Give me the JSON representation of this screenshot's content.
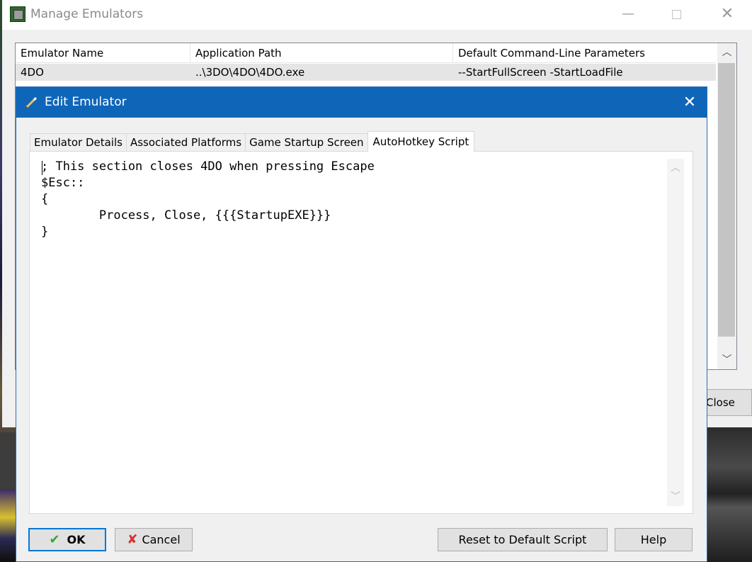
{
  "manage_window": {
    "title": "Manage Emulators",
    "columns": [
      "Emulator Name",
      "Application Path",
      "Default Command-Line Parameters"
    ],
    "rows": [
      {
        "name": "4DO",
        "path": "..\\3DO\\4DO\\4DO.exe",
        "params": "--StartFullScreen -StartLoadFile"
      }
    ],
    "partial_button_label": "Close"
  },
  "edit_dialog": {
    "title": "Edit Emulator",
    "tabs": [
      {
        "label": "Emulator Details",
        "active": false
      },
      {
        "label": "Associated Platforms",
        "active": false
      },
      {
        "label": "Game Startup Screen",
        "active": false
      },
      {
        "label": "AutoHotkey Script",
        "active": true
      }
    ],
    "script": "; This section closes 4DO when pressing Escape\n$Esc::\n{\n\tProcess, Close, {{{StartupEXE}}}\n}",
    "buttons": {
      "ok": "OK",
      "cancel": "Cancel",
      "reset": "Reset to Default Script",
      "help": "Help"
    }
  },
  "colors": {
    "dialog_titlebar": "#0f66b9",
    "ok_border": "#0078d7",
    "check": "#3aa33a",
    "cancel_x": "#d93030"
  }
}
